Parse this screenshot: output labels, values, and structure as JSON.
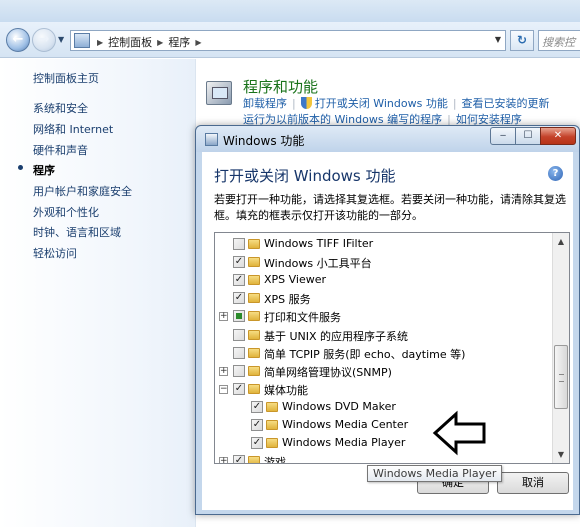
{
  "explorer": {
    "breadcrumb": [
      "控制面板",
      "程序"
    ],
    "search_placeholder": "搜索控"
  },
  "sidebar": {
    "items": [
      {
        "label": "控制面板主页",
        "current": false
      },
      {
        "label": "系统和安全",
        "current": false
      },
      {
        "label": "网络和 Internet",
        "current": false
      },
      {
        "label": "硬件和声音",
        "current": false
      },
      {
        "label": "程序",
        "current": true
      },
      {
        "label": "用户帐户和家庭安全",
        "current": false
      },
      {
        "label": "外观和个性化",
        "current": false
      },
      {
        "label": "时钟、语言和区域",
        "current": false
      },
      {
        "label": "轻松访问",
        "current": false
      }
    ]
  },
  "programs": {
    "title": "程序和功能",
    "links_row1": [
      "卸载程序",
      "打开或关闭 Windows 功能",
      "查看已安装的更新"
    ],
    "links_row2": [
      "运行为以前版本的 Windows 编写的程序",
      "如何安装程序"
    ]
  },
  "dialog": {
    "title": "Windows 功能",
    "heading": "打开或关闭 Windows 功能",
    "description": "若要打开一种功能，请选择其复选框。若要关闭一种功能，请清除其复选框。填充的框表示仅打开该功能的一部分。",
    "features": [
      {
        "label": "Windows TIFF IFilter",
        "state": "unchecked",
        "expander": "",
        "level": 0
      },
      {
        "label": "Windows 小工具平台",
        "state": "checked",
        "expander": "",
        "level": 0
      },
      {
        "label": "XPS Viewer",
        "state": "checked",
        "expander": "",
        "level": 0
      },
      {
        "label": "XPS 服务",
        "state": "checked",
        "expander": "",
        "level": 0
      },
      {
        "label": "打印和文件服务",
        "state": "partial",
        "expander": "+",
        "level": 0
      },
      {
        "label": "基于 UNIX 的应用程序子系统",
        "state": "unchecked",
        "expander": "",
        "level": 0
      },
      {
        "label": "简单 TCPIP 服务(即 echo、daytime 等)",
        "state": "unchecked",
        "expander": "",
        "level": 0
      },
      {
        "label": "简单网络管理协议(SNMP)",
        "state": "unchecked",
        "expander": "+",
        "level": 0
      },
      {
        "label": "媒体功能",
        "state": "checked",
        "expander": "−",
        "level": 0
      },
      {
        "label": "Windows DVD Maker",
        "state": "checked",
        "expander": "",
        "level": 1
      },
      {
        "label": "Windows Media Center",
        "state": "checked",
        "expander": "",
        "level": 1
      },
      {
        "label": "Windows Media Player",
        "state": "checked",
        "expander": "",
        "level": 1
      },
      {
        "label": "游戏",
        "state": "checked",
        "expander": "+",
        "level": 0
      }
    ],
    "ok_label": "确定",
    "cancel_label": "取消",
    "tooltip": "Windows Media Player"
  }
}
